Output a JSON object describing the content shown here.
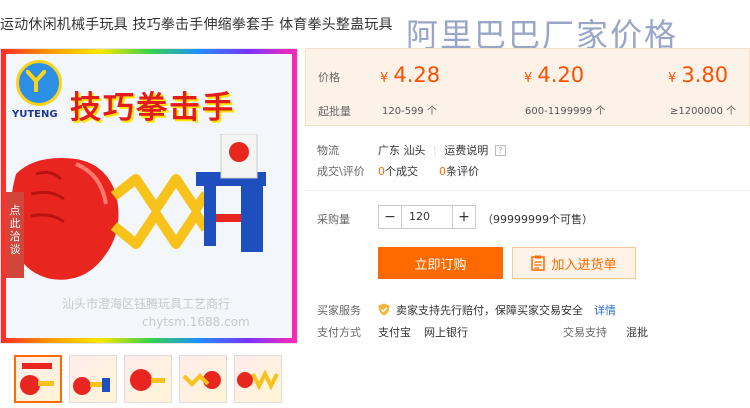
{
  "product": {
    "title": "运动休闲机械手玩具 技巧拳击手伸缩拳套手 体育拳头整蛊玩具",
    "watermark": "阿里巴巴厂家价格"
  },
  "image": {
    "logo_text": "YUTENG",
    "banner_text": "技巧拳击手",
    "caption": "汕头市澄海区钰腾玩具工艺商行",
    "url_text": "chytsm.1688.com",
    "side_tag": [
      "点",
      "此",
      "洽",
      "谈"
    ]
  },
  "price_box": {
    "price_label": "价格",
    "qty_label": "起批量",
    "currency": "¥",
    "tiers": [
      {
        "price": "4.28",
        "qty": "120-599 个"
      },
      {
        "price": "4.20",
        "qty": "600-1199999 个"
      },
      {
        "price": "3.80",
        "qty": "≥1200000 个"
      }
    ]
  },
  "logistics": {
    "label": "物流",
    "location": "广东 汕头",
    "shipping_link": "运费说明"
  },
  "trades": {
    "label": "成交\\评价",
    "deals_count": "0",
    "deals_text": "个成交",
    "reviews_count": "0",
    "reviews_text": "条评价"
  },
  "purchase": {
    "label": "采购量",
    "minus": "−",
    "plus": "+",
    "quantity": "120",
    "available": "（99999999个可售）"
  },
  "buttons": {
    "buy": "立即订购",
    "cart": "加入进货单"
  },
  "service": {
    "label": "买家服务",
    "text": "卖家支持先行赔付，保障买家交易安全",
    "detail_link": "详情"
  },
  "payment": {
    "label": "支付方式",
    "methods": [
      "支付宝",
      "网上银行"
    ],
    "trade_label": "交易支持",
    "trade_value": "混批"
  },
  "colors": {
    "accent": "#ff6a00",
    "price": "#ff5000",
    "price_bg": "#fdf2e8"
  }
}
